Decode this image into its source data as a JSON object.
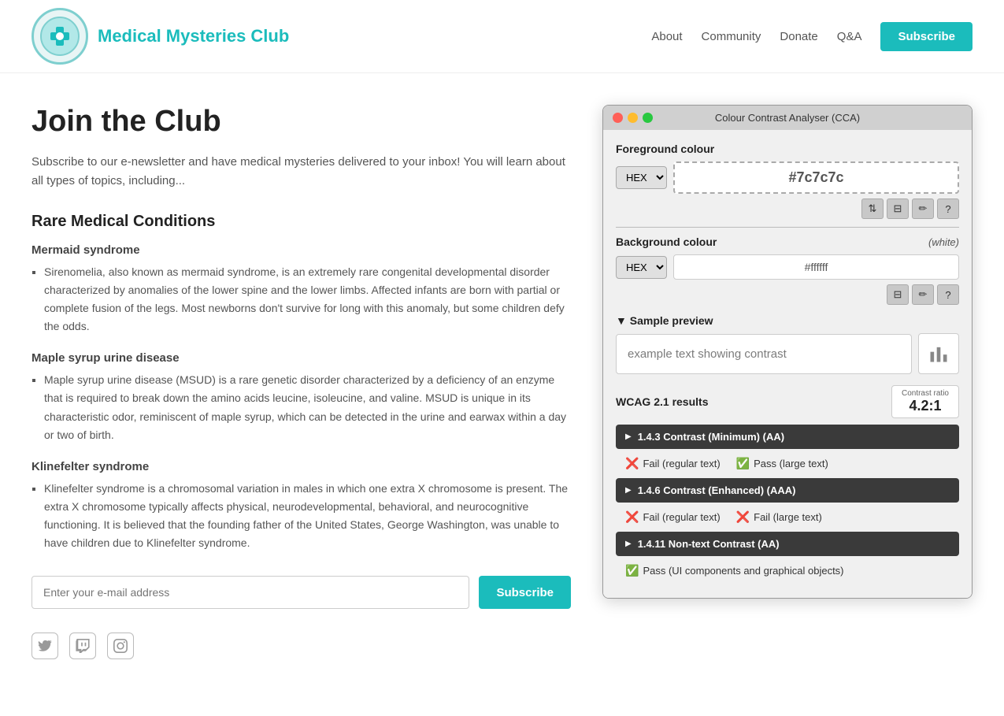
{
  "navbar": {
    "title": "Medical Mysteries Club",
    "links": [
      "About",
      "Community",
      "Donate",
      "Q&A"
    ],
    "subscribe_label": "Subscribe"
  },
  "content": {
    "page_title": "Join the Club",
    "intro": "Subscribe to our e-newsletter and have medical mysteries delivered to your inbox! You will learn about all types of topics, including...",
    "section_title": "Rare Medical Conditions",
    "conditions": [
      {
        "title": "Mermaid syndrome",
        "text": "Sirenomelia, also known as mermaid syndrome, is an extremely rare congenital developmental disorder characterized by anomalies of the lower spine and the lower limbs. Affected infants are born with partial or complete fusion of the legs. Most newborns don't survive for long with this anomaly, but some children defy the odds."
      },
      {
        "title": "Maple syrup urine disease",
        "text": "Maple syrup urine disease (MSUD) is a rare genetic disorder characterized by a deficiency of an enzyme that is required to break down the amino acids leucine, isoleucine, and valine. MSUD is unique in its characteristic odor, reminiscent of maple syrup, which can be detected in the urine and earwax within a day or two of birth."
      },
      {
        "title": "Klinefelter syndrome",
        "text": "Klinefelter syndrome is a chromosomal variation in males in which one extra X chromosome is present. The extra X chromosome typically affects physical, neurodevelopmental, behavioral, and neurocognitive functioning. It is believed that the founding father of the United States, George Washington, was unable to have children due to Klinefelter syndrome."
      }
    ],
    "email_placeholder": "Enter your e-mail address",
    "subscribe_btn": "Subscribe"
  },
  "cca": {
    "title": "Colour Contrast Analyser (CCA)",
    "foreground_label": "Foreground colour",
    "foreground_format": "HEX",
    "foreground_value": "#7c7c7c",
    "background_label": "Background colour",
    "background_hint": "(white)",
    "background_format": "HEX",
    "background_value": "#ffffff",
    "sample_section_label": "▼ Sample preview",
    "sample_text": "example text showing contrast",
    "wcag_label": "WCAG 2.1 results",
    "contrast_ratio_label": "Contrast ratio",
    "contrast_ratio_value": "4.2:1",
    "results": [
      {
        "id": "1.4.3",
        "label": "1.4.3 Contrast (Minimum) (AA)",
        "sub": [
          {
            "pass": false,
            "text": "Fail (regular text)"
          },
          {
            "pass": true,
            "text": "Pass (large text)"
          }
        ]
      },
      {
        "id": "1.4.6",
        "label": "1.4.6 Contrast (Enhanced) (AAA)",
        "sub": [
          {
            "pass": false,
            "text": "Fail (regular text)"
          },
          {
            "pass": false,
            "text": "Fail (large text)"
          }
        ]
      },
      {
        "id": "1.4.11",
        "label": "1.4.11 Non-text Contrast (AA)",
        "sub": [
          {
            "pass": true,
            "text": "Pass (UI components and graphical objects)"
          }
        ]
      }
    ]
  }
}
